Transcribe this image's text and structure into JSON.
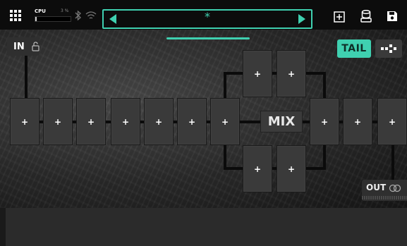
{
  "topbar": {
    "cpu_label": "CPU",
    "cpu_percent": "3 %",
    "cpu_level": 0.03,
    "preset_name": "*"
  },
  "chain": {
    "in_label": "IN",
    "tail_label": "TAIL",
    "mix_label": "MIX",
    "out_label": "OUT",
    "block_label": "+"
  },
  "colors": {
    "accent": "#3fd0b0",
    "background": "#0c0c0c",
    "block": "#3a3a3a"
  },
  "icons": [
    "grid-menu-icon",
    "bluetooth-icon",
    "wifi-icon",
    "add-block-icon",
    "library-icon",
    "save-icon",
    "unlock-icon",
    "layout-icon",
    "link-icon"
  ]
}
